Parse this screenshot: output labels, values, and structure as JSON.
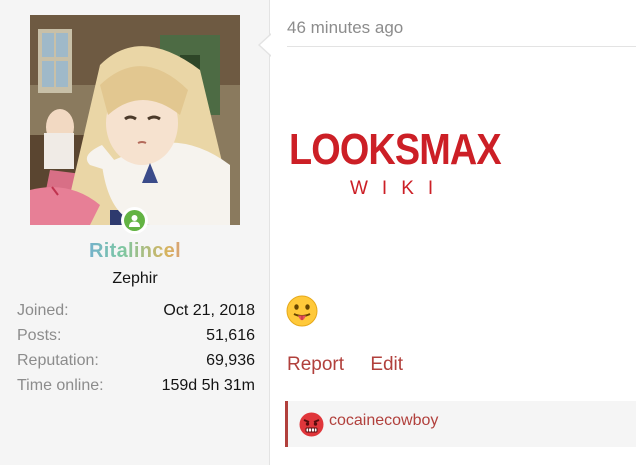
{
  "user": {
    "name": "Ritalincel",
    "title": "Zephir",
    "avatar_icon": "anime-girl-avatar",
    "status_icon": "online-status-icon",
    "stats": [
      {
        "label": "Joined:",
        "value": "Oct 21, 2018"
      },
      {
        "label": "Posts:",
        "value": "51,616"
      },
      {
        "label": "Reputation:",
        "value": "69,936"
      },
      {
        "label": "Time online:",
        "value": "159d 5h 31m"
      }
    ]
  },
  "post": {
    "timestamp": "46 minutes ago",
    "logo": {
      "main": "LOOKSMAX",
      "sub": "WIKI",
      "color": "#cc1f26"
    },
    "emoji_icon": "tongue-out-emoji",
    "actions": {
      "report": "Report",
      "edit": "Edit"
    },
    "reactions": {
      "icon": "angry-face-emoji",
      "user": "cocainecowboy"
    }
  },
  "colors": {
    "accent": "#b1403c",
    "panel_bg": "#f5f5f5",
    "muted": "#8c8c8c",
    "online": "#63b343"
  }
}
